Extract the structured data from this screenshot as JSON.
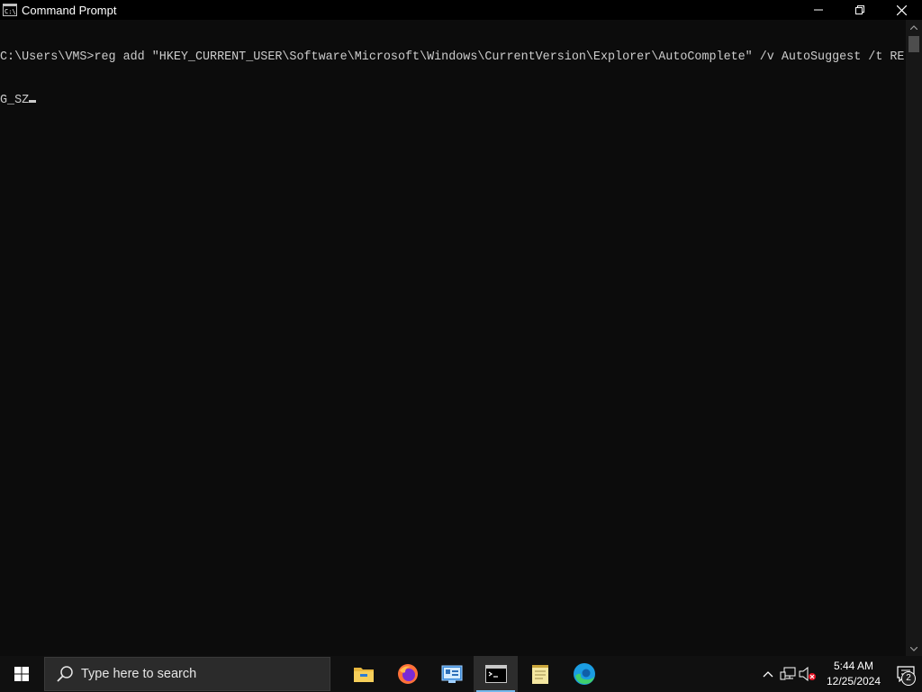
{
  "window": {
    "title": "Command Prompt",
    "app_icon": "cmd-icon",
    "controls": [
      "minimize-icon",
      "restore-icon",
      "close-icon"
    ]
  },
  "console": {
    "lines": [
      "C:\\Users\\VMS>reg add \"HKEY_CURRENT_USER\\Software\\Microsoft\\Windows\\CurrentVersion\\Explorer\\AutoComplete\" /v AutoSuggest /t RE",
      "G_SZ"
    ]
  },
  "taskbar": {
    "search_placeholder": "Type here to search",
    "apps": [
      {
        "name": "file-explorer",
        "icon": "folder-icon",
        "active": false
      },
      {
        "name": "firefox",
        "icon": "firefox-icon",
        "active": false
      },
      {
        "name": "control-panel",
        "icon": "control-panel-icon",
        "active": false
      },
      {
        "name": "command-prompt",
        "icon": "cmd-icon",
        "active": true
      },
      {
        "name": "notepad",
        "icon": "notepad-icon",
        "active": false
      },
      {
        "name": "edge",
        "icon": "edge-icon",
        "active": false
      }
    ],
    "clock": {
      "time": "5:44 AM",
      "date": "12/25/2024"
    },
    "notification_count": "2"
  },
  "colors": {
    "console_bg": "#0c0c0c",
    "console_text": "#cccccc",
    "taskbar_bg": "#101010",
    "accent": "#76b9ed"
  }
}
